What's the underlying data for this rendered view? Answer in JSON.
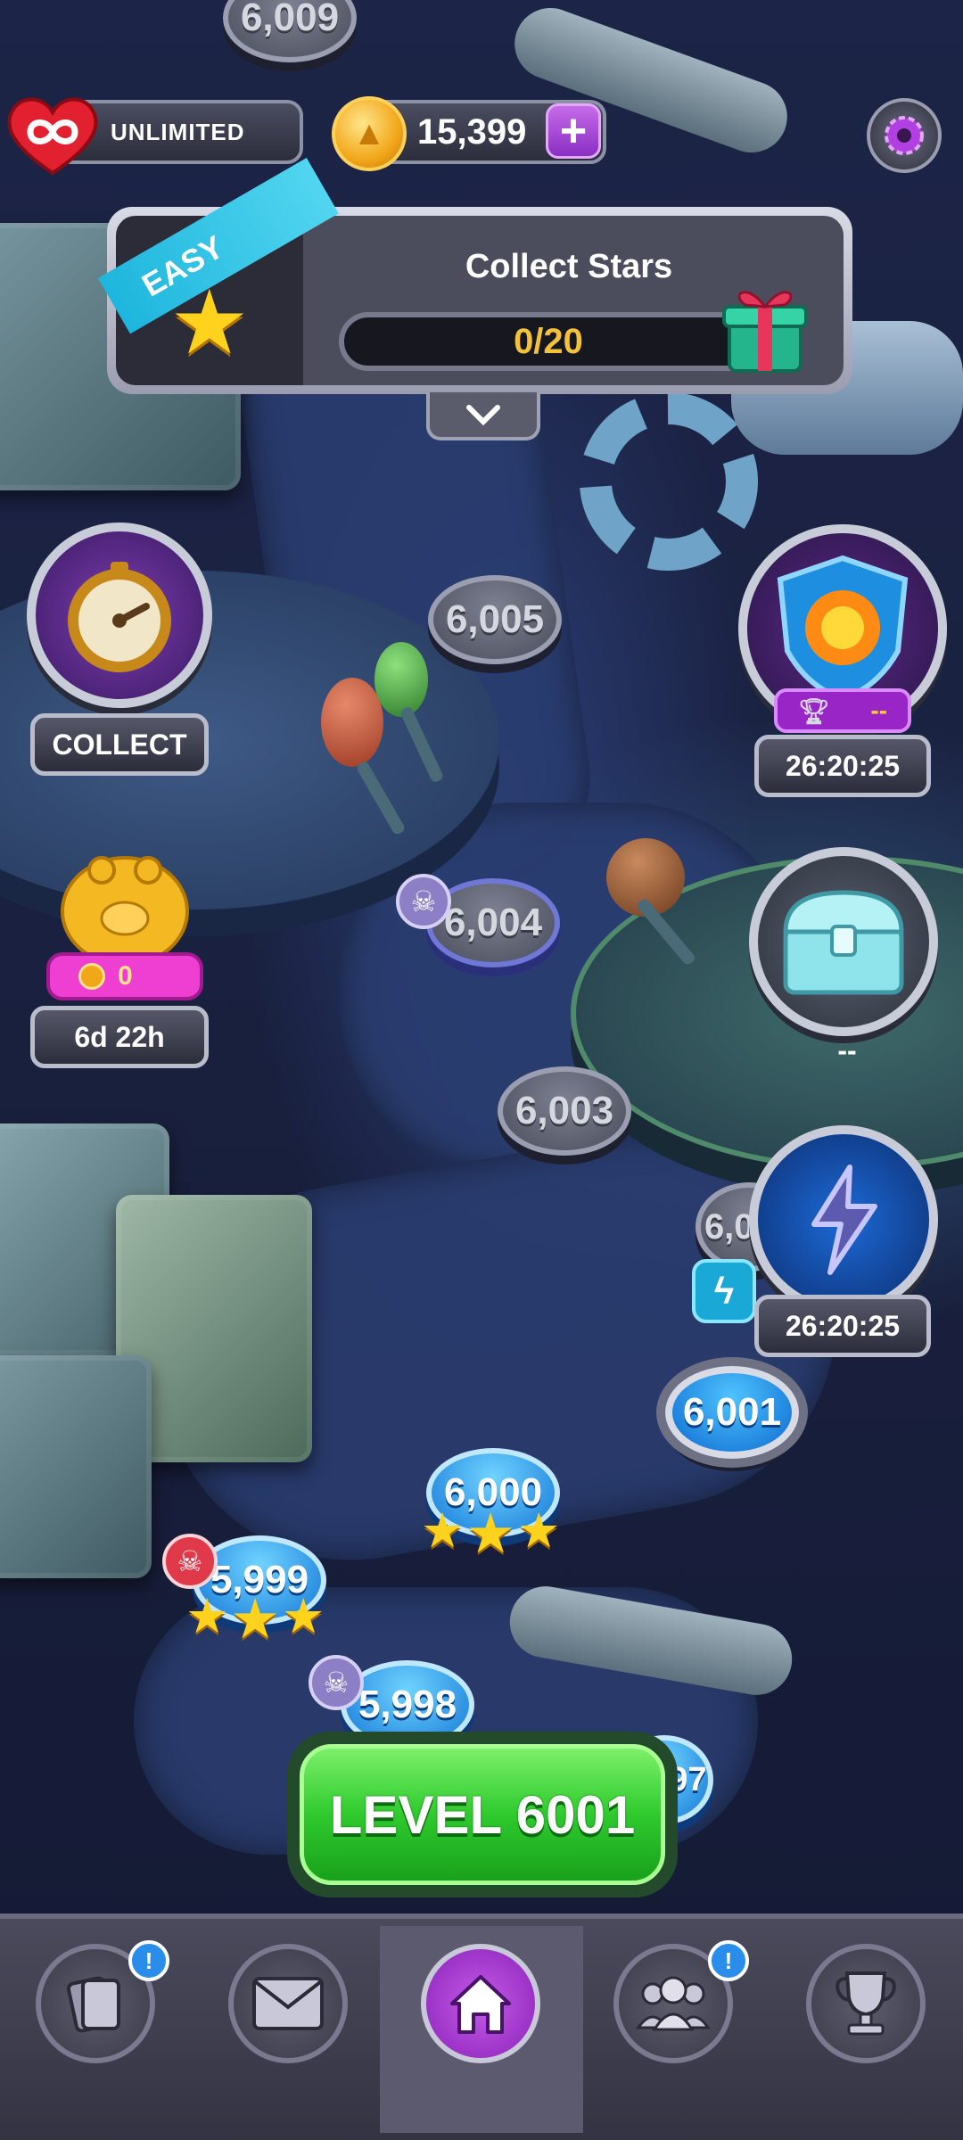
{
  "hud": {
    "lives_label": "UNLIMITED",
    "lives_icon": "infinity-heart-icon",
    "coins": "15,399",
    "coin_icon": "coin-icon",
    "add_coins_icon": "plus-icon",
    "settings_icon": "settings-icon"
  },
  "quest": {
    "difficulty": "EASY",
    "title": "Collect Stars",
    "progress_text": "0/20",
    "progress": 0.0,
    "reward_icon": "gift-icon",
    "collapse_icon": "chevron-down-icon"
  },
  "map": {
    "levels": [
      {
        "label": "6,009",
        "state": "locked"
      },
      {
        "label": "6,005",
        "state": "locked"
      },
      {
        "label": "6,004",
        "state": "locked"
      },
      {
        "label": "6,003",
        "state": "locked"
      },
      {
        "label": "6,002",
        "state": "locked"
      },
      {
        "label": "6,001",
        "state": "current"
      },
      {
        "label": "6,000",
        "state": "done",
        "stars": 3
      },
      {
        "label": "5,999",
        "state": "done",
        "stars": 3
      },
      {
        "label": "5,998",
        "state": "done"
      },
      {
        "label": "5,997",
        "state": "done"
      }
    ]
  },
  "widgets": {
    "timer_reward": {
      "button": "COLLECT",
      "icon": "stopwatch-icon"
    },
    "piggy_bank": {
      "amount": "0",
      "timer": "6d 22h",
      "icon": "piggy-bank-icon"
    },
    "league": {
      "rank": "--",
      "timer": "26:20:25",
      "icon": "shield-fire-icon",
      "trophy_icon": "trophy-icon"
    },
    "chest": {
      "label": "--",
      "icon": "chest-icon"
    },
    "lightning_event": {
      "timer": "26:20:25",
      "icon": "lightning-icon",
      "marker_icon": "lightning-bubble-icon"
    }
  },
  "level_button": {
    "label": "LEVEL 6001"
  },
  "nav": {
    "items": [
      {
        "name": "cards",
        "icon": "cards-icon",
        "badge": "!"
      },
      {
        "name": "inbox",
        "icon": "mail-icon"
      },
      {
        "name": "home",
        "icon": "home-icon",
        "active": true
      },
      {
        "name": "team",
        "icon": "team-icon",
        "badge": "!"
      },
      {
        "name": "leaderboard",
        "icon": "trophy-icon"
      }
    ]
  },
  "colors": {
    "accent_purple": "#b140e0",
    "play_green": "#2fca2e",
    "completed_blue": "#1679d8",
    "star_yellow": "#ffd21e"
  }
}
